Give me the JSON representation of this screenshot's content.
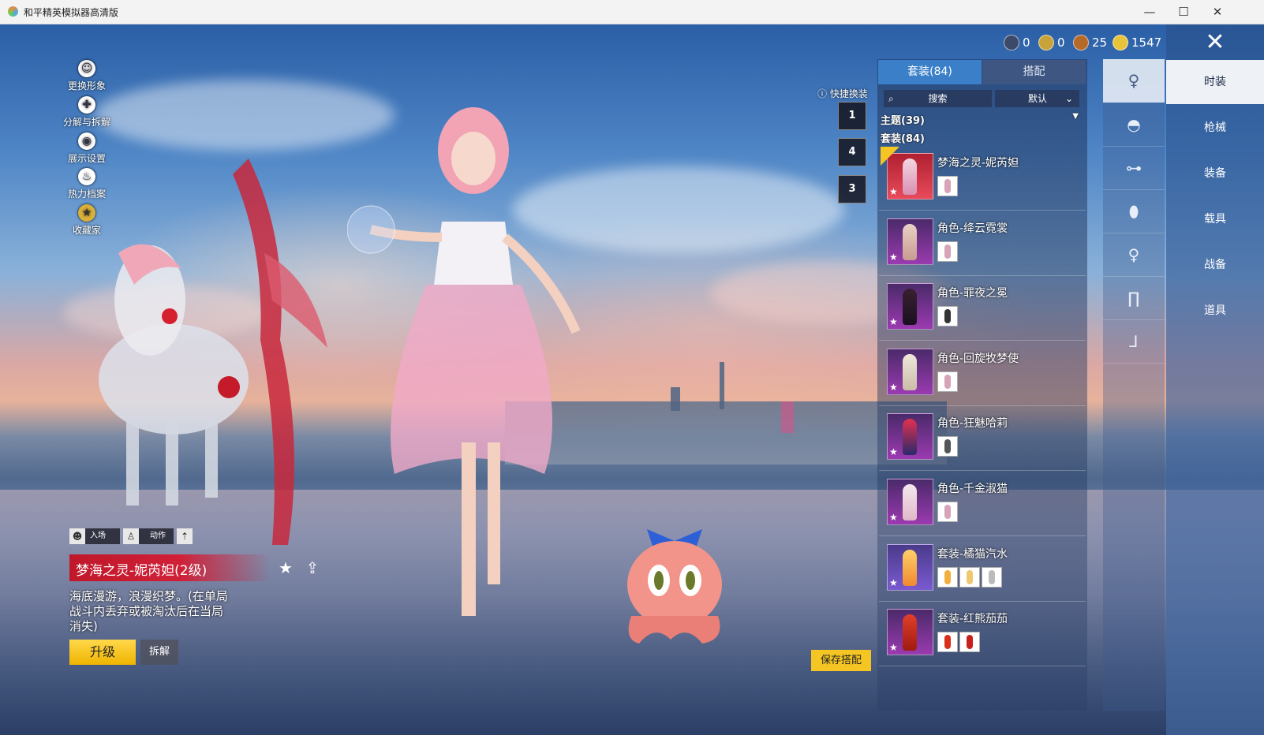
{
  "window": {
    "title": "和平精英模拟器高清版",
    "minimize": "—",
    "maximize": "☐",
    "close": "✕"
  },
  "currencies": [
    {
      "icon": "currency-coin-dark-icon",
      "value": "0",
      "color": "#3c4a6a"
    },
    {
      "icon": "currency-coin-gold-ring-icon",
      "value": "0",
      "color": "#c8a33a"
    },
    {
      "icon": "currency-coin-bronze-icon",
      "value": "25",
      "color": "#b56a2a"
    },
    {
      "icon": "currency-coin-yellow-icon",
      "value": "1547",
      "color": "#e8c43a"
    }
  ],
  "left_menu": [
    {
      "label": "更换形象",
      "icon": "avatar-icon"
    },
    {
      "label": "分解与拆解",
      "icon": "puzzle-icon"
    },
    {
      "label": "展示设置",
      "icon": "eye-icon"
    },
    {
      "label": "热力档案",
      "icon": "flame-icon"
    },
    {
      "label": "收藏家",
      "icon": "collector-badge-icon"
    }
  ],
  "quick_change": {
    "label": "快捷换装",
    "slots": [
      "1",
      "4",
      "3"
    ]
  },
  "panel": {
    "tabs": [
      {
        "label": "套装(84)",
        "active": true
      },
      {
        "label": "搭配",
        "active": false
      }
    ],
    "search_placeholder": "搜索",
    "sort_value": "默认",
    "section_theme": "主题(39)",
    "section_suits": "套装(84)",
    "items": [
      {
        "name": "梦海之灵-妮芮妲",
        "minis": 1,
        "selected": true
      },
      {
        "name": "角色-绛云霓裳",
        "minis": 1
      },
      {
        "name": "角色-罪夜之冕",
        "minis": 1
      },
      {
        "name": "角色-回旋牧梦使",
        "minis": 1
      },
      {
        "name": "角色-狂魅哈莉",
        "minis": 1
      },
      {
        "name": "角色-千金淑猫",
        "minis": 1
      },
      {
        "name": "套装-橘猫汽水",
        "minis": 3
      },
      {
        "name": "套装-红熊茄茄",
        "minis": 2
      }
    ]
  },
  "categories": [
    {
      "icon": "outfit-figure-icon",
      "active": true
    },
    {
      "icon": "cap-icon"
    },
    {
      "icon": "glasses-icon"
    },
    {
      "icon": "mask-icon"
    },
    {
      "icon": "body-suit-icon"
    },
    {
      "icon": "pants-icon"
    },
    {
      "icon": "shoes-icon"
    }
  ],
  "right_tabs": [
    {
      "label": "时装",
      "active": true
    },
    {
      "label": "枪械"
    },
    {
      "label": "装备"
    },
    {
      "label": "载具"
    },
    {
      "label": "战备"
    },
    {
      "label": "道具"
    }
  ],
  "action_bar": {
    "entrance": "入场",
    "action": "动作"
  },
  "selected": {
    "name": "梦海之灵-妮芮妲(2级)",
    "description": "海底漫游，浪漫织梦。(在单局战斗内丢弃或被淘汰后在当局消失)",
    "upgrade": "升级",
    "dismantle": "拆解"
  },
  "save_button": "保存搭配"
}
